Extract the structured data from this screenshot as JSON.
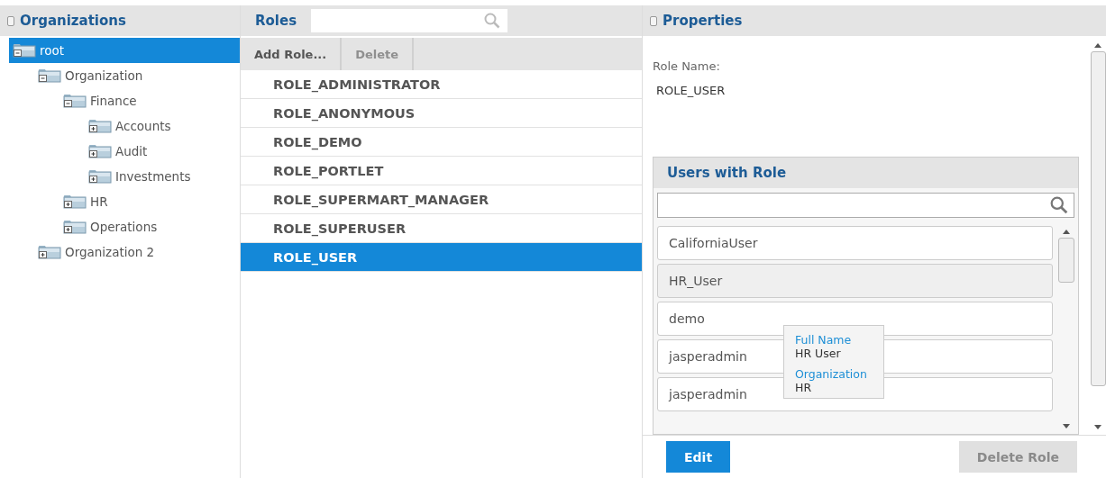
{
  "organizations": {
    "title": "Organizations",
    "tree": [
      {
        "label": "root",
        "selected": true,
        "expanded": true,
        "children": [
          {
            "label": "Organization",
            "selected": false,
            "expanded": true,
            "children": [
              {
                "label": "Finance",
                "selected": false,
                "expanded": true,
                "children": [
                  {
                    "label": "Accounts",
                    "selected": false,
                    "expanded": false
                  },
                  {
                    "label": "Audit",
                    "selected": false,
                    "expanded": false
                  },
                  {
                    "label": "Investments",
                    "selected": false,
                    "expanded": false
                  }
                ]
              },
              {
                "label": "HR",
                "selected": false,
                "expanded": false
              },
              {
                "label": "Operations",
                "selected": false,
                "expanded": false
              }
            ]
          },
          {
            "label": "Organization 2",
            "selected": false,
            "expanded": false
          }
        ]
      }
    ]
  },
  "roles": {
    "title": "Roles",
    "buttons": [
      {
        "label": "Add Role...",
        "disabled": false
      },
      {
        "label": "Delete",
        "disabled": true
      }
    ],
    "items": [
      {
        "label": "ROLE_ADMINISTRATOR",
        "selected": false
      },
      {
        "label": "ROLE_ANONYMOUS",
        "selected": false
      },
      {
        "label": "ROLE_DEMO",
        "selected": false
      },
      {
        "label": "ROLE_PORTLET",
        "selected": false
      },
      {
        "label": "ROLE_SUPERMART_MANAGER",
        "selected": false
      },
      {
        "label": "ROLE_SUPERUSER",
        "selected": false
      },
      {
        "label": "ROLE_USER",
        "selected": true
      }
    ]
  },
  "properties": {
    "title": "Properties",
    "role_name_label": "Role Name:",
    "role_name": "ROLE_USER",
    "users_with_role": {
      "title": "Users with Role",
      "users": [
        {
          "name": "CaliforniaUser",
          "hovered": false
        },
        {
          "name": "HR_User",
          "hovered": true
        },
        {
          "name": "demo",
          "hovered": false
        },
        {
          "name": "jasperadmin",
          "hovered": false
        },
        {
          "name": "jasperadmin",
          "hovered": false
        }
      ],
      "tooltip": [
        {
          "label": "Full Name",
          "value": "HR User"
        },
        {
          "label": "Organization",
          "value": "HR"
        }
      ]
    },
    "buttons": [
      {
        "label": "Edit",
        "kind": "primary",
        "disabled": false
      },
      {
        "label": "Delete Role",
        "kind": "secondary",
        "disabled": true
      }
    ]
  }
}
